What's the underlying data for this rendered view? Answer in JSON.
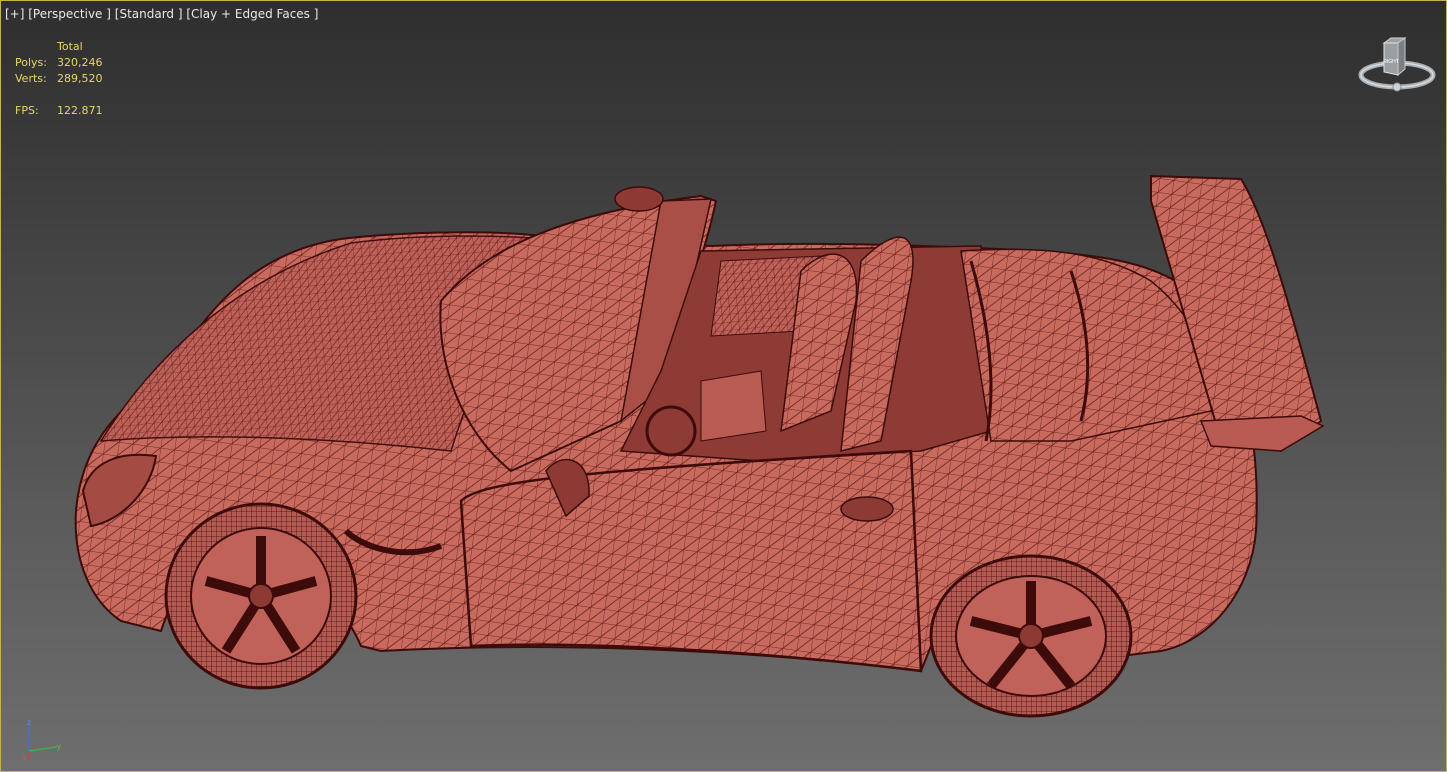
{
  "viewport": {
    "label_plus": "[+]",
    "label_view": "[Perspective ]",
    "label_shading": "[Standard ]",
    "label_style": "[Clay + Edged Faces ]"
  },
  "stats": {
    "header": "Total",
    "polys_label": "Polys:",
    "polys_value": "320,246",
    "verts_label": "Verts:",
    "verts_value": "289,520",
    "fps_label": "FPS:",
    "fps_value": "122.871"
  },
  "viewcube": {
    "face_label": "RIGHT"
  },
  "axis": {
    "z": "z",
    "x": "x",
    "y": "y"
  },
  "colors": {
    "clay": "#c86a5e",
    "wire": "#5a1614",
    "frame": "#c9b14a",
    "stats_text": "#e6d66a"
  }
}
